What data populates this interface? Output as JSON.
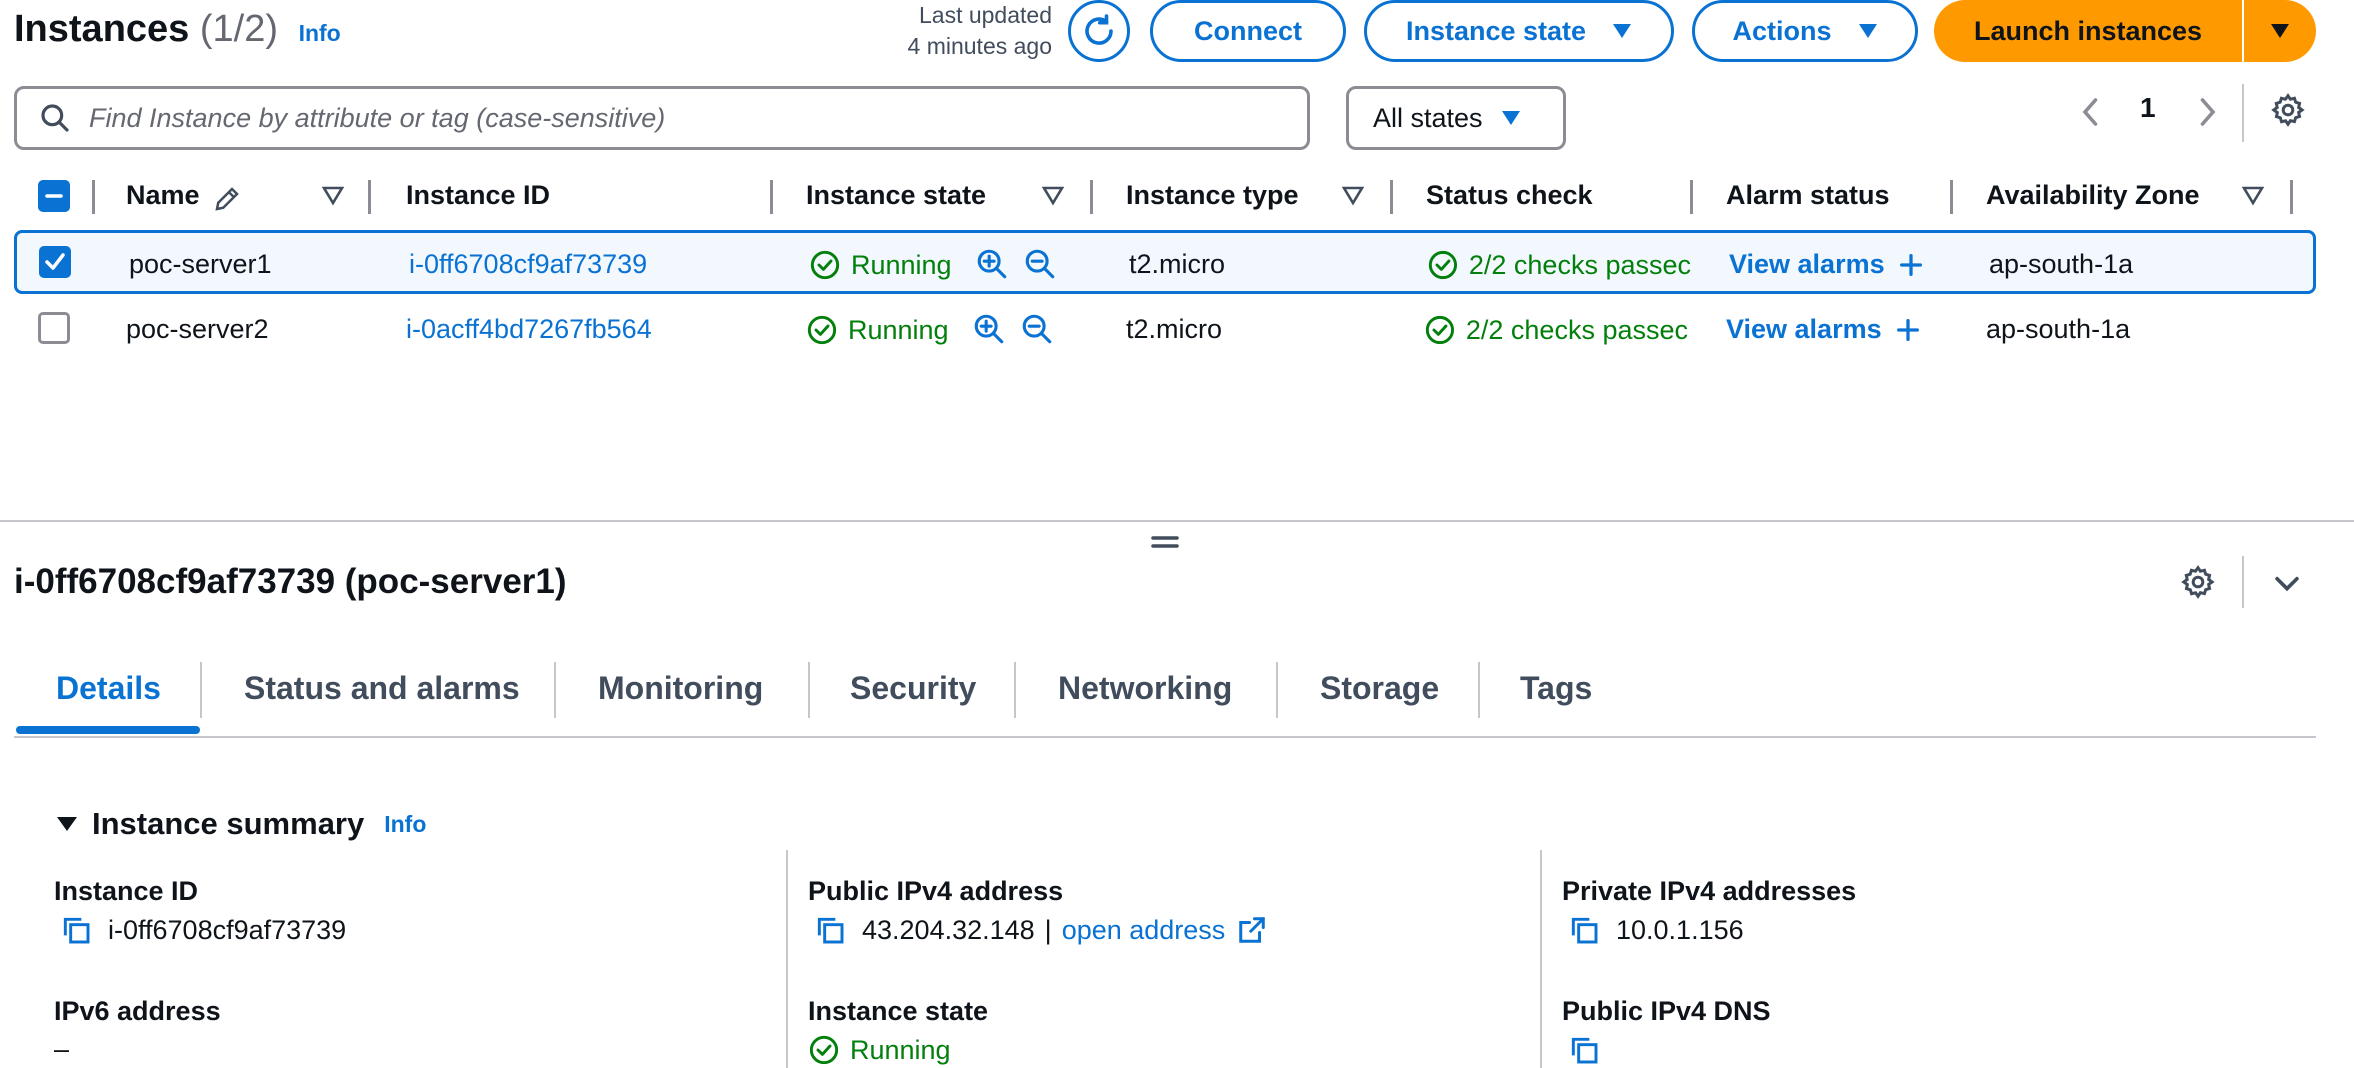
{
  "header": {
    "title": "Instances",
    "count": "(1/2)",
    "info": "Info",
    "last_updated_line1": "Last updated",
    "last_updated_line2": "4 minutes ago",
    "connect": "Connect",
    "instance_state": "Instance state",
    "actions": "Actions",
    "launch": "Launch instances"
  },
  "filter": {
    "search_placeholder": "Find Instance by attribute or tag (case-sensitive)",
    "state_filter": "All states",
    "page": "1"
  },
  "table": {
    "columns": [
      "Name",
      "Instance ID",
      "Instance state",
      "Instance type",
      "Status check",
      "Alarm status",
      "Availability Zone"
    ],
    "rows": [
      {
        "name": "poc-server1",
        "id": "i-0ff6708cf9af73739",
        "state": "Running",
        "type": "t2.micro",
        "check": "2/2 checks passec",
        "alarm": "View alarms",
        "az": "ap-south-1a",
        "selected": true
      },
      {
        "name": "poc-server2",
        "id": "i-0acff4bd7267fb564",
        "state": "Running",
        "type": "t2.micro",
        "check": "2/2 checks passec",
        "alarm": "View alarms",
        "az": "ap-south-1a",
        "selected": false
      }
    ]
  },
  "detail": {
    "title": "i-0ff6708cf9af73739 (poc-server1)",
    "tabs": [
      "Details",
      "Status and alarms",
      "Monitoring",
      "Security",
      "Networking",
      "Storage",
      "Tags"
    ],
    "active_tab": "Details",
    "section": "Instance summary",
    "section_info": "Info",
    "fields": {
      "instance_id_label": "Instance ID",
      "instance_id_value": "i-0ff6708cf9af73739",
      "ipv6_label": "IPv6 address",
      "ipv6_value": "–",
      "public_ipv4_label": "Public IPv4 address",
      "public_ipv4_value": "43.204.32.148",
      "public_ipv4_sep": "|",
      "open_address": "open address",
      "instance_state_label": "Instance state",
      "instance_state_value": "Running",
      "private_ipv4_label": "Private IPv4 addresses",
      "private_ipv4_value": "10.0.1.156",
      "public_dns_label": "Public IPv4 DNS"
    }
  },
  "colors": {
    "link": "#0972d3",
    "primary": "#ff9900",
    "success": "#037f0c",
    "border": "#8c8c94"
  },
  "icons": [
    "refresh-icon",
    "caret-down-icon",
    "search-icon",
    "chevron-left-icon",
    "chevron-right-icon",
    "settings-icon",
    "pencil-icon",
    "sort-icon",
    "check-circle-icon",
    "zoom-in-icon",
    "zoom-out-icon",
    "plus-icon",
    "drag-handle-icon",
    "chevron-down-icon",
    "copy-icon",
    "external-link-icon"
  ]
}
